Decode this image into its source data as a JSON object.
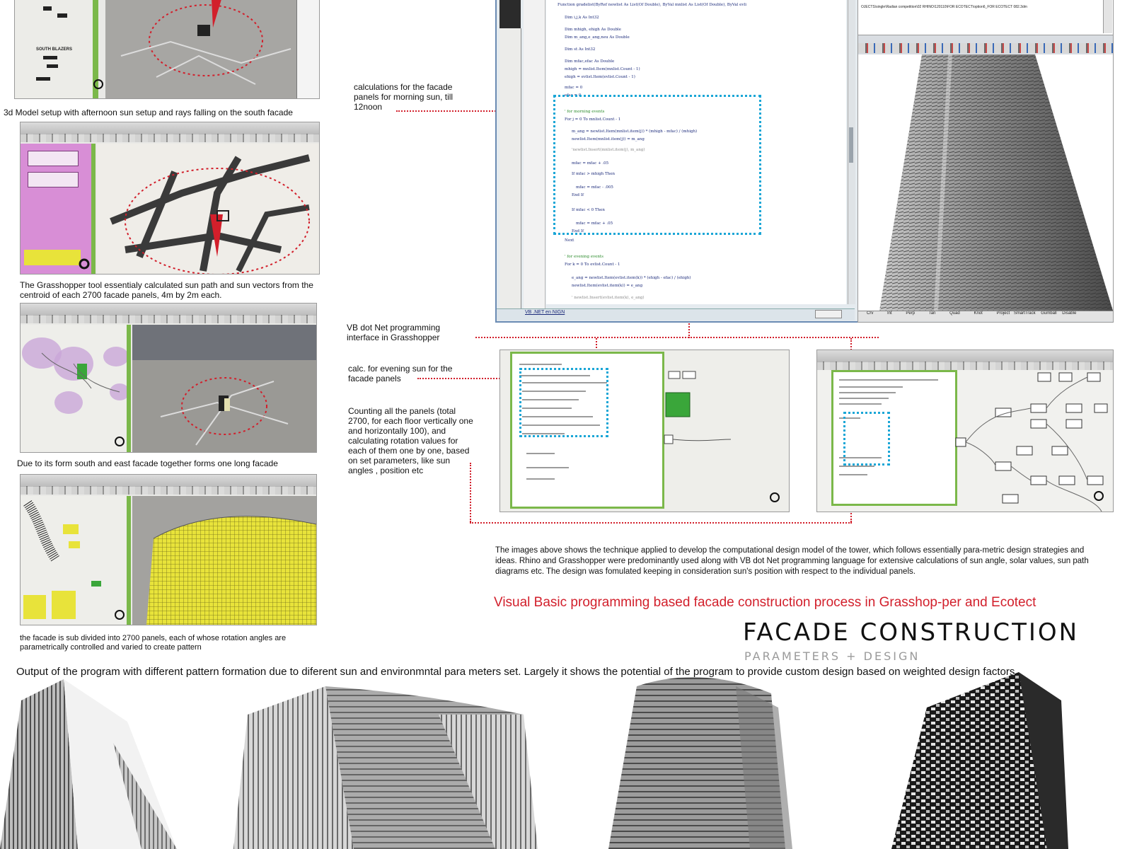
{
  "left_column": {
    "caption_1": "3d Model setup with afternoon sun setup and rays falling on the south facade",
    "caption_2": "The Grasshopper tool essentialy calculated sun path and sun vectors from the centroid of each 2700 facade panels, 4m by 2m each.",
    "caption_3": "Due to its form south and east facade together forms one long facade",
    "caption_4": "the facade is sub divided into 2700 panels, each of whose rotation angles are parametrically controlled and varied to create pattern"
  },
  "annotations": {
    "morning": "calculations for the facade panels for morning sun, till 12noon",
    "vbnet": "VB dot Net programming interface in Grasshopper",
    "evening": "calc. for evening sun for the facade panels",
    "counting": "Counting all the panels (total 2700, for each floor vertically one and horizontally 100), and calculating rotation values for each of them one by one, based on set parameters, like sun angles , position etc"
  },
  "code_window": {
    "signature": "Function gradelist(ByRef newlist As List(Of Double), ByVal mnlist As List(Of Double), ByVal evli",
    "lines": [
      "Dim i,j,k As Int32",
      "Dim mhigh, ehigh As Double",
      "Dim m_ang,e_ang,neu As Double",
      "Dim st As Int32",
      "Dim mfac,efac As Double",
      "mhigh = mnlist.Item(mnlist.Count - 1)",
      "ehigh = evlist.Item(evlist.Count - 1)",
      "mfac = 0",
      "efac = 0",
      "' for morning events",
      "For j = 0 To mnlist.Count - 1",
      "m_ang = newlist.Item(mnlist.item(j)) * (mhigh - mfac) / (mhigh)",
      "newlist.Item(mnlist.item(j)) = m_ang",
      "'newlist.Insert(mnlist.item(j), m_ang)",
      "mfac = mfac + .05",
      "If mfac > mhigh Then",
      "mfac = mfac - .005",
      "End If",
      "If mfac < 0 Then",
      "mfac = mfac + .05",
      "End If",
      "Next",
      "' for evening events",
      "For k = 0 To evlist.Count - 1",
      "e_ang = newlist.Item(evlist.item(k)) * (ehigh - efac) / (ehigh)",
      "newlist.Item(evlist.item(k)) = e_ang",
      "' newlist.Insert(evlist.item(k), e_ang)"
    ],
    "tab_label": "VB .NET en NIGN"
  },
  "rhino_window": {
    "path_text": "OJECTS\\single\\Radian competition\\02 RHINO\\120110\\FOR ECOTECT\\option6_FOR ECOTECT 082.3dm",
    "status_items": [
      "Crv",
      "Int",
      "Perp",
      "Tan",
      "Quad",
      "Knot",
      "Project",
      "SmartTrack",
      "Gumball",
      "Disable"
    ]
  },
  "description": "The images above shows the technique applied to develop the computational design model of the tower, which follows essentially para-metric design strategies and ideas. Rhino and Grasshopper were predominantly used along with VB dot Net programming language for extensive calculations of sun angle, solar values, sun path diagrams etc. The design was fomulated keeping in consideration sun's position with respect to the individual panels.",
  "red_caption": "Visual Basic programming based facade construction process in Grasshop-per and Ecotect",
  "title": {
    "main": "FACADE CONSTRUCTION",
    "sub": "PARAMETERS + DESIGN"
  },
  "output_caption": "Output of the program with different pattern formation due to diferent sun and environmntal para meters set. Largely it shows the potential of the program to provide custom design based on weighted design factors",
  "colors": {
    "annotation_red": "#d21f2b",
    "highlight_blue": "#1aa6d6",
    "grasshopper_green": "#7bb84a",
    "canvas_pink": "#d88ed6",
    "facade_yellow": "#e8e33a"
  },
  "icons": [
    "sun-ray-icon",
    "rhino-viewport",
    "grasshopper-canvas"
  ]
}
